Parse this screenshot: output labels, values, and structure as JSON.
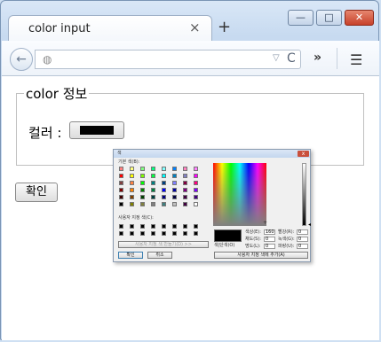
{
  "browser": {
    "tab_title": "color input",
    "tab_close": "×",
    "new_tab": "+",
    "window_min": "—",
    "window_max": "□",
    "window_close": "✕",
    "back": "←",
    "globe": "◍",
    "url_dropdown": "▽",
    "reload": "C",
    "overflow": "»",
    "menu": "☰"
  },
  "page": {
    "legend": "color 정보",
    "color_label": "컬러 :",
    "color_value": "#000000",
    "submit_label": "확인"
  },
  "color_dialog": {
    "title": "색",
    "close": "x",
    "basic_colors_label": "기본 색(B):",
    "basic_colors": [
      "#ff8080",
      "#ffff80",
      "#80ff80",
      "#00ff80",
      "#80ffff",
      "#0080ff",
      "#ff80c0",
      "#ff80ff",
      "#ff0000",
      "#ffff00",
      "#80ff00",
      "#00ff40",
      "#00ffff",
      "#0080c0",
      "#8080c0",
      "#ff00ff",
      "#804040",
      "#ff8040",
      "#00ff00",
      "#008080",
      "#004080",
      "#8080ff",
      "#800040",
      "#ff0080",
      "#800000",
      "#ff8000",
      "#008000",
      "#008040",
      "#0000ff",
      "#0000a0",
      "#800080",
      "#8000ff",
      "#400000",
      "#804000",
      "#004000",
      "#004040",
      "#000080",
      "#000040",
      "#400040",
      "#400080",
      "#000000",
      "#808000",
      "#808040",
      "#808080",
      "#408080",
      "#c0c0c0",
      "#400040",
      "#ffffff"
    ],
    "custom_colors_label": "사용자 지정 색(C):",
    "custom_colors": [
      "#000000",
      "#000000",
      "#000000",
      "#000000",
      "#000000",
      "#000000",
      "#000000",
      "#000000",
      "#000000",
      "#000000",
      "#000000",
      "#000000",
      "#000000",
      "#000000",
      "#000000",
      "#000000"
    ],
    "define_custom_button": "사용자 지정 색 만들기(D) >>",
    "ok_button": "확인",
    "cancel_button": "취소",
    "solid_label": "색|단색(O)",
    "hue_label": "색상(E):",
    "hue_value": "160",
    "sat_label": "채도(S):",
    "sat_value": "0",
    "lum_label": "명도(L):",
    "lum_value": "0",
    "red_label": "빨강(R):",
    "red_value": "0",
    "green_label": "녹색(G):",
    "green_value": "0",
    "blue_label": "파랑(U):",
    "blue_value": "0",
    "add_custom_button": "사용자 지정 색에 추가(A)"
  }
}
